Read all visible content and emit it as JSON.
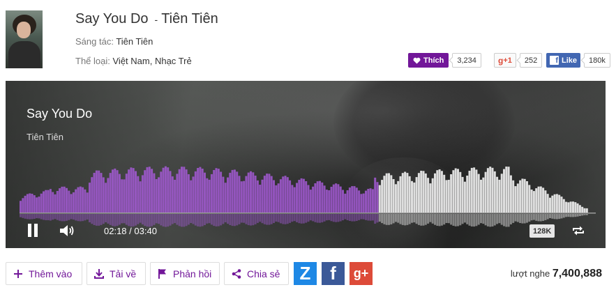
{
  "song": {
    "title": "Say You Do",
    "separator": "-",
    "artist": "Tiên Tiên",
    "composer_label": "Sáng tác:",
    "composer": "Tiên Tiên",
    "genre_label": "Thể loại:",
    "genres": "Việt Nam, Nhạc Trẻ"
  },
  "social": {
    "like_label": "Thích",
    "like_count": "3,234",
    "gplus_label": "+1",
    "gplus_count": "252",
    "fb_label": "Like",
    "fb_count": "180k",
    "accent": "#721799",
    "fb_color": "#4267b2"
  },
  "player": {
    "title": "Say You Do",
    "artist": "Tiên Tiên",
    "current_time": "02:18",
    "total_time": "03:40",
    "time_separator": " / ",
    "progress": 0.627,
    "quality": "128K",
    "played_color": "#a45bd6",
    "unplayed_color": "#f2f2f2",
    "icons": [
      "pause-icon",
      "volume-icon",
      "repeat-icon"
    ]
  },
  "toolbar": {
    "add_label": "Thêm vào",
    "download_label": "Tải về",
    "feedback_label": "Phản hồi",
    "share_label": "Chia sẻ",
    "zing_label": "Z",
    "facebook_label": "f",
    "gplus_label": "g+"
  },
  "stats": {
    "listens_label": "lượt nghe",
    "listens": "7,400,888"
  }
}
